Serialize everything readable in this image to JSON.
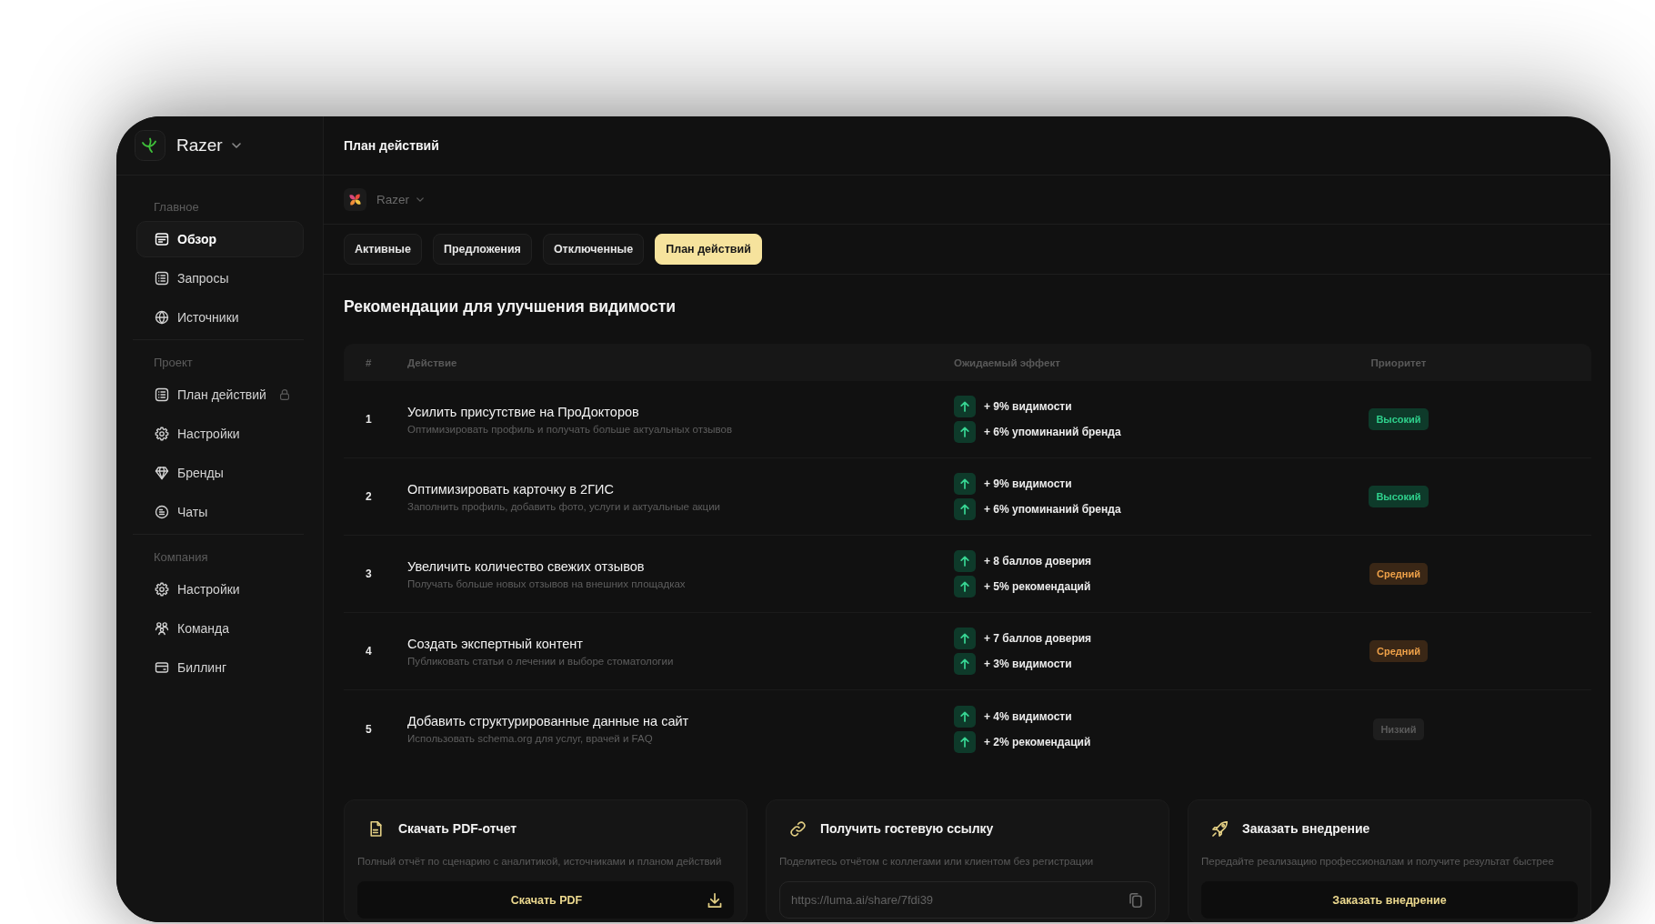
{
  "sidebar": {
    "workspace": {
      "name": "Razer"
    },
    "sections": [
      {
        "title": "Главное",
        "items": [
          {
            "label": "Обзор",
            "kind": "overview",
            "selected": true,
            "locked": false
          },
          {
            "label": "Запросы",
            "kind": "queries",
            "selected": false,
            "locked": false
          },
          {
            "label": "Источники",
            "kind": "sources",
            "selected": false,
            "locked": false
          }
        ]
      },
      {
        "title": "Проект",
        "items": [
          {
            "label": "План действий",
            "kind": "plan",
            "selected": false,
            "locked": true
          },
          {
            "label": "Настройки",
            "kind": "settings",
            "selected": false,
            "locked": false
          },
          {
            "label": "Бренды",
            "kind": "brands",
            "selected": false,
            "locked": false
          },
          {
            "label": "Чаты",
            "kind": "chats",
            "selected": false,
            "locked": false
          }
        ]
      },
      {
        "title": "Компания",
        "items": [
          {
            "label": "Настройки",
            "kind": "settings",
            "selected": false,
            "locked": false
          },
          {
            "label": "Команда",
            "kind": "team",
            "selected": false,
            "locked": false
          },
          {
            "label": "Биллинг",
            "kind": "billing",
            "selected": false,
            "locked": false
          }
        ]
      }
    ]
  },
  "main": {
    "title": "План действий",
    "brand_selector": {
      "name": "Razer"
    },
    "tabs": [
      {
        "label": "Активные",
        "selected": false
      },
      {
        "label": "Предложения",
        "selected": false
      },
      {
        "label": "Отключенные",
        "selected": false
      },
      {
        "label": "План действий",
        "selected": true
      }
    ],
    "section_title": "Рекомендации для улучшения видимости",
    "table": {
      "columns": [
        "#",
        "Действие",
        "Ожидаемый эффект",
        "Приоритет"
      ],
      "rows": [
        {
          "number": "1",
          "title": "Усилить присутствие на ПроДокторов",
          "description": "Оптимизировать профиль и получать больше актуальных отзывов",
          "effects": [
            "+ 9% видимости",
            "+ 6% упоминаний бренда"
          ],
          "priority": {
            "label": "Высокий",
            "kind": "high"
          }
        },
        {
          "number": "2",
          "title": "Оптимизировать карточку в 2ГИС",
          "description": "Заполнить профиль, добавить фото, услуги и актуальные акции",
          "effects": [
            "+ 9% видимости",
            "+ 6% упоминаний бренда"
          ],
          "priority": {
            "label": "Высокий",
            "kind": "high"
          }
        },
        {
          "number": "3",
          "title": "Увеличить количество свежих отзывов",
          "description": "Получать больше новых отзывов на внешних площадках",
          "effects": [
            "+ 8 баллов доверия",
            "+ 5% рекомендаций"
          ],
          "priority": {
            "label": "Средний",
            "kind": "medium"
          }
        },
        {
          "number": "4",
          "title": "Создать экспертный контент",
          "description": "Публиковать статьи о лечении и выборе стоматологии",
          "effects": [
            "+ 7 баллов доверия",
            "+ 3% видимости"
          ],
          "priority": {
            "label": "Средний",
            "kind": "medium"
          }
        },
        {
          "number": "5",
          "title": "Добавить структурированные данные на сайт",
          "description": "Использовать schema.org для услуг, врачей и FAQ",
          "effects": [
            "+ 4% видимости",
            "+ 2% рекомендаций"
          ],
          "priority": {
            "label": "Низкий",
            "kind": "low"
          }
        }
      ]
    },
    "cards": [
      {
        "kind": "report",
        "title": "Скачать PDF-отчет",
        "description": "Полный отчёт по сценарию с аналитикой, источниками и планом действий",
        "action": {
          "kind": "download",
          "label": "Скачать PDF"
        }
      },
      {
        "kind": "share",
        "title": "Получить гостевую ссылку",
        "description": "Поделитесь отчётом с коллегами или клиентом без регистрации",
        "action": {
          "kind": "field",
          "value": "https://luma.ai/share/7fdi39"
        }
      },
      {
        "kind": "service",
        "title": "Заказать внедрение",
        "description": "Передайте реализацию профессионалам и получите результат быстрее",
        "action": {
          "kind": "button",
          "label": "Заказать внедрение"
        }
      }
    ]
  }
}
